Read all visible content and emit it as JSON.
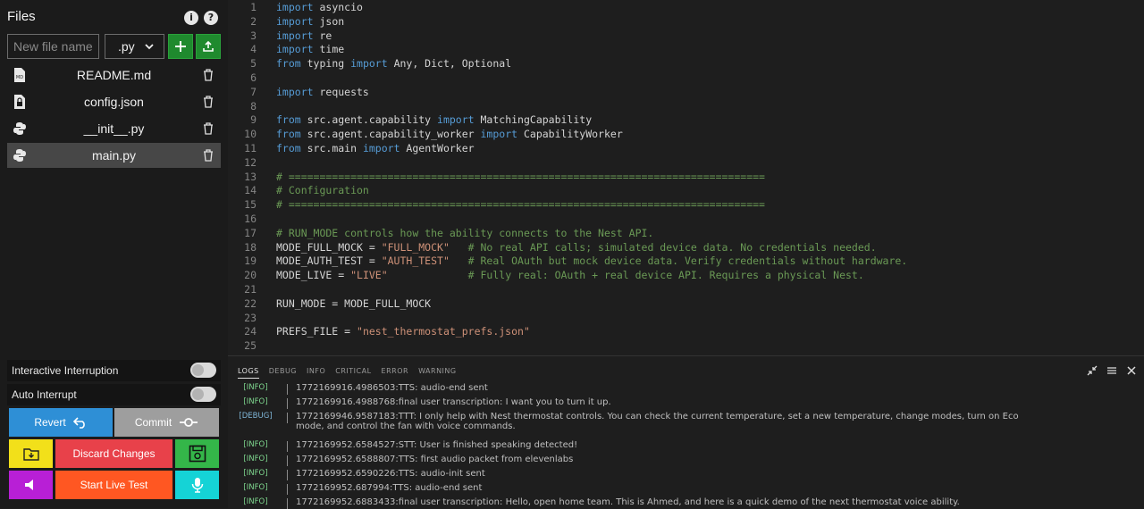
{
  "sidebar": {
    "title": "Files",
    "new_file_placeholder": "New file name",
    "extension": ".py",
    "files": [
      {
        "name": "README.md",
        "icon": "markdown-file-icon"
      },
      {
        "name": "config.json",
        "icon": "lock-file-icon"
      },
      {
        "name": "__init__.py",
        "icon": "python-icon"
      },
      {
        "name": "main.py",
        "icon": "python-icon",
        "active": true
      }
    ],
    "toggles": [
      {
        "label": "Interactive Interruption",
        "on": false
      },
      {
        "label": "Auto Interrupt",
        "on": false
      }
    ],
    "buttons": {
      "revert": "Revert",
      "commit": "Commit",
      "discard": "Discard Changes",
      "live_test": "Start Live Test"
    }
  },
  "colors": {
    "revert": "#2e8fd6",
    "commit": "#9e9e9e",
    "yellow": "#f2e01a",
    "discard": "#e8414a",
    "save": "#34b649",
    "purple": "#b81fd6",
    "live": "#ff5722",
    "cyan": "#15d3d6"
  },
  "editor": {
    "lines": [
      {
        "n": "1",
        "t": [
          [
            "kw",
            "import"
          ],
          [
            "",
            "asyncio"
          ]
        ]
      },
      {
        "n": "2",
        "t": [
          [
            "kw",
            "import"
          ],
          [
            "",
            "json"
          ]
        ]
      },
      {
        "n": "3",
        "t": [
          [
            "kw",
            "import"
          ],
          [
            "",
            "re"
          ]
        ]
      },
      {
        "n": "4",
        "t": [
          [
            "kw",
            "import"
          ],
          [
            "",
            "time"
          ]
        ]
      },
      {
        "n": "5",
        "t": [
          [
            "kw",
            "from"
          ],
          [
            "",
            " typing "
          ],
          [
            "kw",
            "import"
          ],
          [
            "",
            " Any, Dict, Optional"
          ]
        ]
      },
      {
        "n": "6",
        "t": []
      },
      {
        "n": "7",
        "t": [
          [
            "kw",
            "import"
          ],
          [
            "",
            " requests"
          ]
        ]
      },
      {
        "n": "8",
        "t": []
      },
      {
        "n": "9",
        "t": [
          [
            "kw",
            "from"
          ],
          [
            "",
            " src.agent.capability "
          ],
          [
            "kw",
            "import"
          ],
          [
            "",
            " MatchingCapability"
          ]
        ]
      },
      {
        "n": "10",
        "t": [
          [
            "kw",
            "from"
          ],
          [
            "",
            " src.agent.capability_worker "
          ],
          [
            "kw",
            "import"
          ],
          [
            "",
            " CapabilityWorker"
          ]
        ]
      },
      {
        "n": "11",
        "t": [
          [
            "kw",
            "from"
          ],
          [
            "",
            " src.main "
          ],
          [
            "kw",
            "import"
          ],
          [
            "",
            " AgentWorker"
          ]
        ]
      },
      {
        "n": "12",
        "t": []
      },
      {
        "n": "13",
        "t": [
          [
            "cm",
            "# ============================================================================="
          ]
        ]
      },
      {
        "n": "14",
        "t": [
          [
            "cm",
            "# Configuration"
          ]
        ]
      },
      {
        "n": "15",
        "t": [
          [
            "cm",
            "# ============================================================================="
          ]
        ]
      },
      {
        "n": "16",
        "t": []
      },
      {
        "n": "17",
        "t": [
          [
            "cm",
            "# RUN_MODE controls how the ability connects to the Nest API."
          ]
        ]
      },
      {
        "n": "18",
        "t": [
          [
            "",
            "MODE_FULL_MOCK = "
          ],
          [
            "str",
            "\"FULL_MOCK\""
          ],
          [
            "",
            "   "
          ],
          [
            "cm",
            "# No real API calls; simulated device data. No credentials needed."
          ]
        ]
      },
      {
        "n": "19",
        "t": [
          [
            "",
            "MODE_AUTH_TEST = "
          ],
          [
            "str",
            "\"AUTH_TEST\""
          ],
          [
            "",
            "   "
          ],
          [
            "cm",
            "# Real OAuth but mock device data. Verify credentials without hardware."
          ]
        ]
      },
      {
        "n": "20",
        "t": [
          [
            "",
            "MODE_LIVE = "
          ],
          [
            "str",
            "\"LIVE\""
          ],
          [
            "",
            "             "
          ],
          [
            "cm",
            "# Fully real: OAuth + real device API. Requires a physical Nest."
          ]
        ]
      },
      {
        "n": "21",
        "t": []
      },
      {
        "n": "22",
        "t": [
          [
            "",
            "RUN_MODE = MODE_FULL_MOCK"
          ]
        ]
      },
      {
        "n": "23",
        "t": []
      },
      {
        "n": "24",
        "t": [
          [
            "",
            "PREFS_FILE = "
          ],
          [
            "str",
            "\"nest_thermostat_prefs.json\""
          ]
        ]
      },
      {
        "n": "25",
        "t": []
      }
    ]
  },
  "logs": {
    "tabs": [
      "LOGS",
      "DEBUG",
      "INFO",
      "CRITICAL",
      "ERROR",
      "WARNING"
    ],
    "entries": [
      {
        "tag": "[INFO]",
        "msg": "1772169916.4986503:TTS: audio-end sent"
      },
      {
        "tag": "[INFO]",
        "msg": "1772169916.4988768:final user transcription: I want you to turn it up."
      },
      {
        "tag": "[DEBUG]",
        "msg": "1772169946.9587183:TTT: I only help with Nest thermostat controls. You can check the current temperature, set a new temperature, change modes, turn on Eco mode, and control the fan with voice commands."
      },
      {
        "tag": "[INFO]",
        "msg": "1772169952.6584527:STT: User is finished speaking detected!"
      },
      {
        "tag": "[INFO]",
        "msg": "1772169952.6588807:TTS: first audio packet from elevenlabs"
      },
      {
        "tag": "[INFO]",
        "msg": "1772169952.6590226:TTS: audio-init sent"
      },
      {
        "tag": "[INFO]",
        "msg": "1772169952.687994:TTS: audio-end sent"
      },
      {
        "tag": "[INFO]",
        "msg": "1772169952.6883433:final user transcription: Hello, open home team. This is Ahmed, and here is a quick demo of the next thermostat voice ability."
      }
    ]
  }
}
